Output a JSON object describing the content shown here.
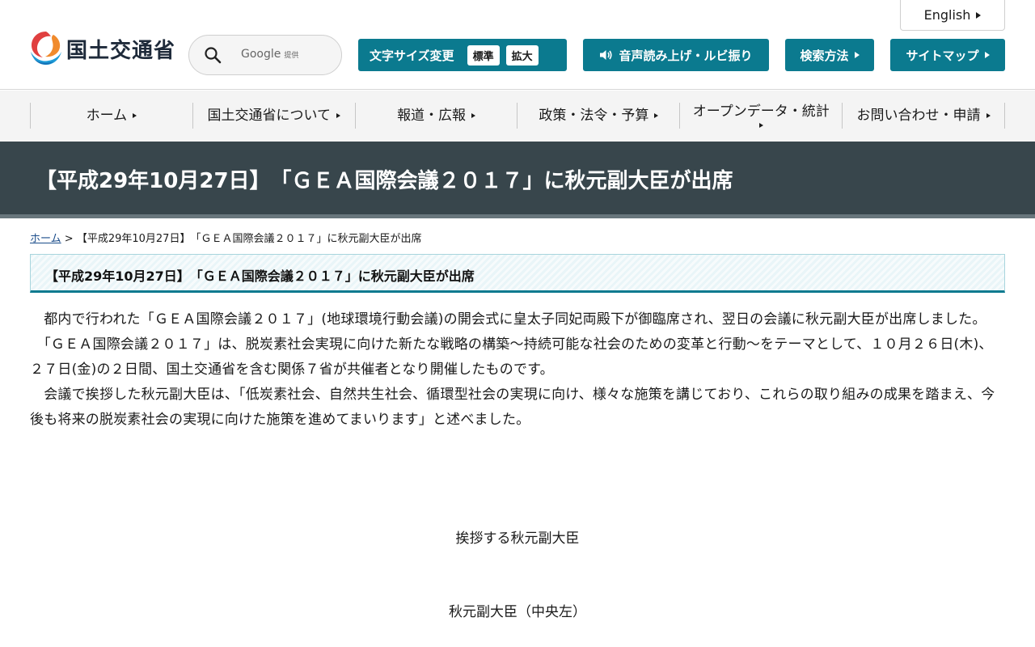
{
  "header": {
    "language_label": "English",
    "logo_text": "国土交通省",
    "search": {
      "brand": "Google",
      "brand_suffix": "提供",
      "placeholder": ""
    },
    "font_size": {
      "label": "文字サイズ変更",
      "standard": "標準",
      "large": "拡大"
    },
    "speech_label": "音声読み上げ・ルビ振り",
    "search_method_label": "検索方法",
    "sitemap_label": "サイトマップ"
  },
  "gnav": {
    "items": [
      "ホーム",
      "国土交通省について",
      "報道・広報",
      "政策・法令・予算",
      "オープンデータ・統計",
      "お問い合わせ・申請"
    ]
  },
  "page": {
    "title": "【平成29年10月27日】　「ＧＥＡ国際会議２０１７」に秋元副大臣が出席",
    "breadcrumb": {
      "home": "ホーム",
      "separator": ">",
      "current": "【平成29年10月27日】　「ＧＥＡ国際会議２０１７」に秋元副大臣が出席"
    },
    "heading": "【平成29年10月27日】　「ＧＥＡ国際会議２０１７」に秋元副大臣が出席",
    "paragraphs": [
      "　都内で行われた「ＧＥＡ国際会議２０１７」(地球環境行動会議)の開会式に皇太子同妃両殿下が御臨席され、翌日の会議に秋元副大臣が出席しました。",
      "　「ＧＥＡ国際会議２０１７」は、脱炭素社会実現に向けた新たな戦略の構築～持続可能な社会のための変革と行動～をテーマとして、１０月２６日(木)、２７日(金)の２日間、国土交通省を含む関係７省が共催者となり開催したものです。",
      "　会議で挨拶した秋元副大臣は、「低炭素社会、自然共生社会、循環型社会の実現に向け、様々な施策を講じており、これらの取り組みの成果を踏まえ、今後も将来の脱炭素社会の実現に向けた施策を進めてまいります」と述べました。"
    ],
    "captions": [
      "挨拶する秋元副大臣",
      "秋元副大臣（中央左）"
    ]
  },
  "colors": {
    "accent": "#0b7a8f",
    "title_band": "#38464c",
    "link": "#1a4c8a"
  }
}
